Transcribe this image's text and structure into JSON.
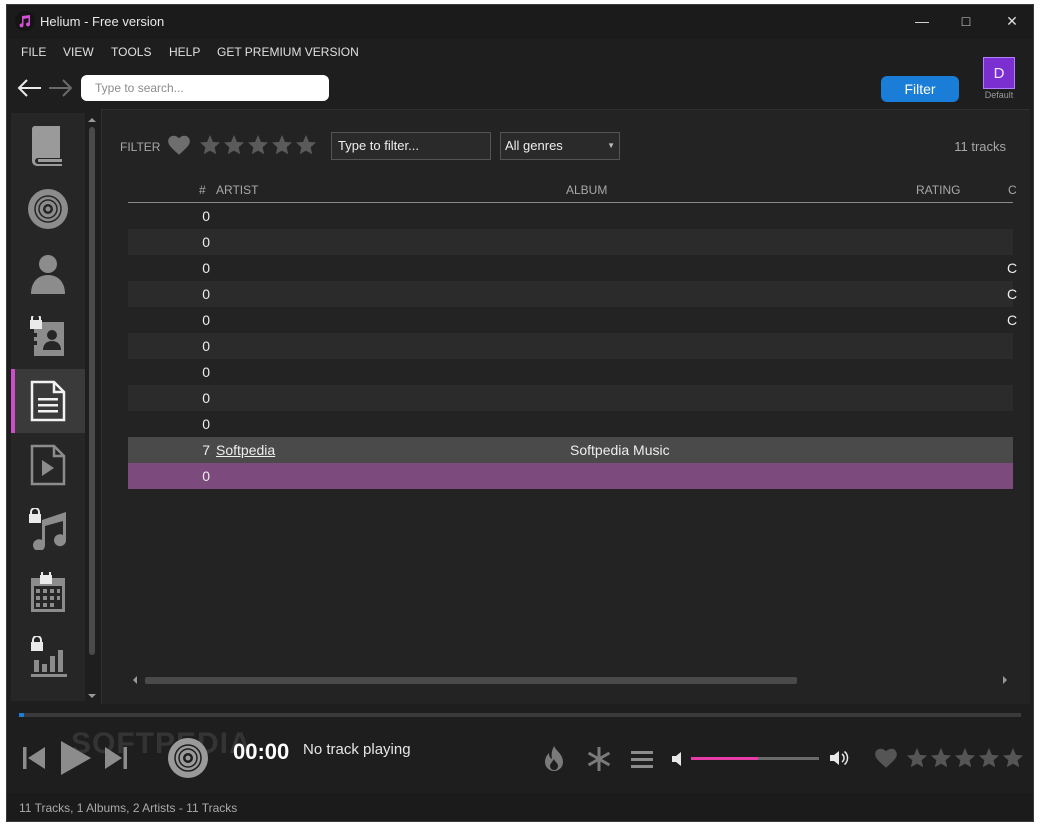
{
  "window": {
    "title": "Helium - Free version",
    "minimize_glyph": "—",
    "maximize_glyph": "□",
    "close_glyph": "✕"
  },
  "menu": [
    "FILE",
    "VIEW",
    "TOOLS",
    "HELP",
    "GET PREMIUM VERSION"
  ],
  "toolbar": {
    "search_placeholder": "Type to search...",
    "filter_button": "Filter",
    "profile_initial": "D",
    "profile_label": "Default"
  },
  "sidebar": {
    "items": [
      {
        "icon": "book-icon",
        "active": false
      },
      {
        "icon": "disc-icon",
        "active": false
      },
      {
        "icon": "person-icon",
        "active": false
      },
      {
        "icon": "locked-contact-icon",
        "active": false
      },
      {
        "icon": "document-list-icon",
        "active": true
      },
      {
        "icon": "video-file-icon",
        "active": false
      },
      {
        "icon": "locked-music-note-icon",
        "active": false
      },
      {
        "icon": "locked-calendar-icon",
        "active": false
      },
      {
        "icon": "locked-bar-chart-icon",
        "active": false
      }
    ]
  },
  "filter_bar": {
    "label": "FILTER",
    "input_value": "Type to filter...",
    "genre_value": "All genres",
    "track_count": "11 tracks"
  },
  "table": {
    "columns": [
      "#",
      "ARTIST",
      "ALBUM",
      "RATING",
      "C"
    ],
    "rows": [
      {
        "num": "0",
        "artist": "",
        "album": "",
        "c": ""
      },
      {
        "num": "0",
        "artist": "",
        "album": "",
        "c": ""
      },
      {
        "num": "0",
        "artist": "",
        "album": "",
        "c": "C"
      },
      {
        "num": "0",
        "artist": "",
        "album": "",
        "c": "C"
      },
      {
        "num": "0",
        "artist": "",
        "album": "",
        "c": "C"
      },
      {
        "num": "0",
        "artist": "",
        "album": "",
        "c": ""
      },
      {
        "num": "0",
        "artist": "",
        "album": "",
        "c": ""
      },
      {
        "num": "0",
        "artist": "",
        "album": "",
        "c": ""
      },
      {
        "num": "0",
        "artist": "",
        "album": "",
        "c": ""
      },
      {
        "num": "7",
        "artist": "Softpedia",
        "album": "Softpedia Music",
        "c": "",
        "state": "selected"
      },
      {
        "num": "0",
        "artist": "",
        "album": "",
        "c": "",
        "state": "playing"
      }
    ]
  },
  "player": {
    "time": "00:00",
    "now_playing": "No track playing",
    "progress_fraction": 0.005,
    "volume_fraction": 0.52,
    "rating_stars": 5,
    "watermark": "SOFTPEDIA"
  },
  "status": {
    "text": "11 Tracks, 1 Albums, 2 Artists - 11 Tracks"
  },
  "colors": {
    "accent_blue": "#1a7dd7",
    "accent_pink": "#e83da8",
    "active_sidebar": "#c94fc9",
    "playing_row": "#7d4a7e"
  }
}
